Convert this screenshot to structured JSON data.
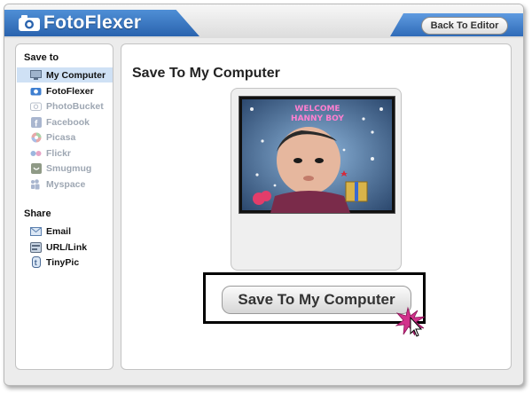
{
  "app": {
    "logo_text": "FotoFlexer",
    "back_button_label": "Back To Editor",
    "colors": {
      "brand_blue": "#2a63ae",
      "selected_row": "#cfe1f5",
      "disabled_text": "#9ea7b3"
    }
  },
  "sidebar": {
    "save_title": "Save to",
    "save_items": [
      {
        "label": "My Computer",
        "icon": "monitor-icon",
        "state": "selected"
      },
      {
        "label": "FotoFlexer",
        "icon": "camera-icon",
        "state": "active"
      },
      {
        "label": "PhotoBucket",
        "icon": "photobucket-icon",
        "state": "disabled"
      },
      {
        "label": "Facebook",
        "icon": "facebook-icon",
        "state": "disabled"
      },
      {
        "label": "Picasa",
        "icon": "picasa-icon",
        "state": "disabled"
      },
      {
        "label": "Flickr",
        "icon": "flickr-icon",
        "state": "disabled"
      },
      {
        "label": "Smugmug",
        "icon": "smugmug-icon",
        "state": "disabled"
      },
      {
        "label": "Myspace",
        "icon": "myspace-icon",
        "state": "disabled"
      }
    ],
    "share_title": "Share",
    "share_items": [
      {
        "label": "Email",
        "icon": "envelope-icon"
      },
      {
        "label": "URL/Link",
        "icon": "link-icon"
      },
      {
        "label": "TinyPic",
        "icon": "tinypic-icon"
      }
    ]
  },
  "main": {
    "title": "Save To My Computer",
    "photo_overlay_text": [
      "WELCOME",
      "HANNY BOY"
    ],
    "save_button_label": "Save To My Computer"
  }
}
